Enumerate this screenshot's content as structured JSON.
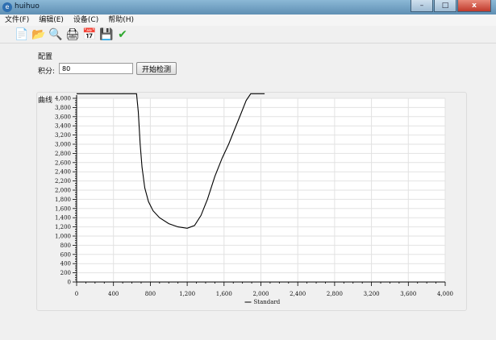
{
  "window": {
    "title": "huihuo",
    "minimize": "–",
    "maximize": "□",
    "close": "x"
  },
  "menu": [
    "文件(F)",
    "编辑(E)",
    "设备(C)",
    "帮助(H)"
  ],
  "toolbar": [
    {
      "icon": "new-file-icon",
      "glyph": "📄"
    },
    {
      "icon": "open-folder-icon",
      "glyph": "📂"
    },
    {
      "icon": "search-icon",
      "glyph": "🔍"
    },
    {
      "icon": "print-icon",
      "glyph": "🖨"
    },
    {
      "icon": "calendar-icon",
      "glyph": "📅"
    },
    {
      "icon": "save-icon",
      "glyph": "💾"
    },
    {
      "icon": "checkmark-icon",
      "glyph": "✔"
    }
  ],
  "config": {
    "section_label": "配置",
    "score_label": "积分:",
    "score_value": "80",
    "start_button": "开始检测"
  },
  "chart_label": "曲线",
  "colors": {
    "checkmark": "#2ea82e",
    "line": "#000000",
    "grid": "#e2e2e2"
  },
  "chart_data": {
    "type": "line",
    "title": "",
    "xlabel": "",
    "ylabel": "",
    "xlim": [
      0,
      4000
    ],
    "ylim": [
      0,
      4000
    ],
    "x_ticks": [
      "0",
      "400",
      "800",
      "1,200",
      "1,600",
      "2,000",
      "2,400",
      "2,800",
      "3,200",
      "3,600",
      "4,000"
    ],
    "y_ticks": [
      "0",
      "200",
      "400",
      "600",
      "800",
      "1,000",
      "1,200",
      "1,400",
      "1,600",
      "1,800",
      "2,000",
      "2,200",
      "2,400",
      "2,600",
      "2,800",
      "3,000",
      "3,200",
      "3,400",
      "3,600",
      "3,800",
      "4,000"
    ],
    "grid": true,
    "legend": "bottom-center",
    "series": [
      {
        "name": "Standard",
        "x": [
          0,
          650,
          670,
          690,
          710,
          740,
          780,
          830,
          900,
          1000,
          1100,
          1200,
          1280,
          1350,
          1420,
          1500,
          1580,
          1650,
          1720,
          1780,
          1840,
          1890,
          1940,
          2040
        ],
        "y": [
          4100,
          4100,
          3700,
          3000,
          2500,
          2050,
          1750,
          1550,
          1400,
          1270,
          1200,
          1170,
          1230,
          1450,
          1800,
          2300,
          2700,
          3000,
          3350,
          3650,
          3950,
          4100,
          4100,
          4100
        ]
      }
    ]
  }
}
